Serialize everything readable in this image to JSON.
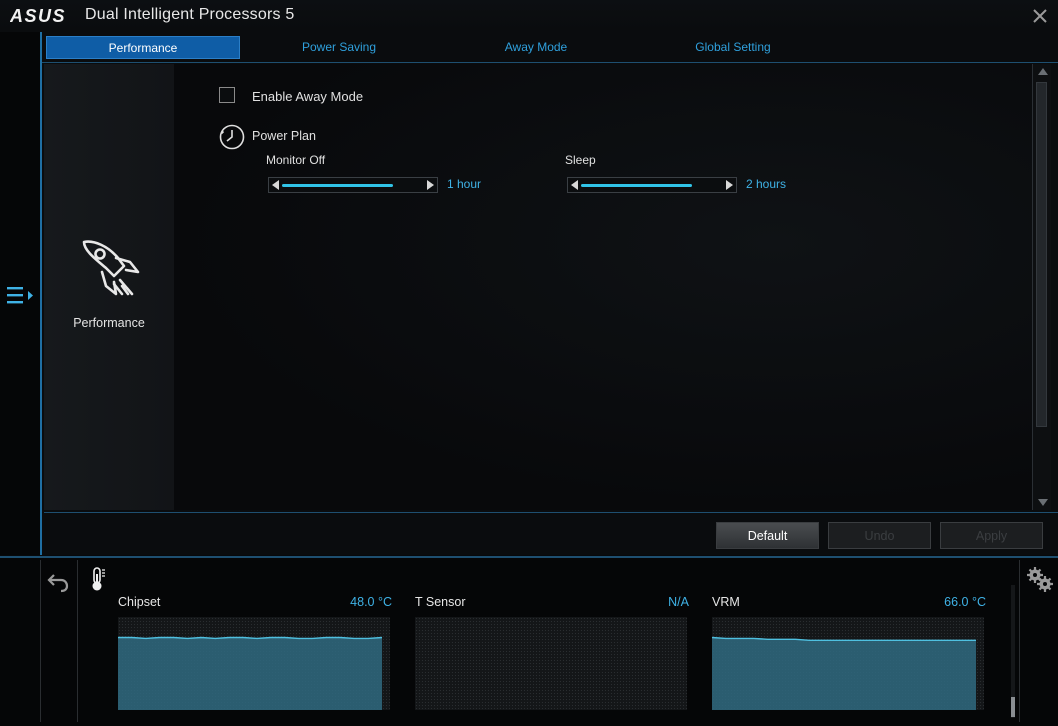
{
  "window": {
    "logo_text": "ASUS",
    "title": "Dual Intelligent Processors 5",
    "close_icon": "close-icon"
  },
  "tabs": [
    {
      "label": "Performance",
      "active": true
    },
    {
      "label": "Power Saving",
      "active": false
    },
    {
      "label": "Away Mode",
      "active": false
    },
    {
      "label": "Global Setting",
      "active": false
    }
  ],
  "sidebar": {
    "icon": "rocket-icon",
    "label": "Performance"
  },
  "away_mode": {
    "enable_label": "Enable Away Mode",
    "enabled": false,
    "power_plan_label": "Power Plan",
    "monitor_off": {
      "title": "Monitor Off",
      "value": "1 hour",
      "level": 0.78
    },
    "sleep": {
      "title": "Sleep",
      "value": "2 hours",
      "level": 0.78
    }
  },
  "buttons": {
    "default": "Default",
    "undo": "Undo",
    "apply": "Apply"
  },
  "monitor": {
    "sensors": [
      {
        "name": "Chipset",
        "value": "48.0 °C",
        "history": [
          0.78,
          0.78,
          0.77,
          0.78,
          0.78,
          0.77,
          0.78,
          0.77,
          0.78,
          0.78,
          0.77,
          0.78,
          0.78,
          0.77,
          0.77,
          0.78,
          0.78,
          0.77,
          0.77,
          0.78
        ]
      },
      {
        "name": "T Sensor",
        "value": "N/A",
        "history": []
      },
      {
        "name": "VRM",
        "value": "66.0 °C",
        "history": [
          0.78,
          0.77,
          0.77,
          0.77,
          0.76,
          0.76,
          0.76,
          0.75,
          0.75,
          0.75,
          0.75,
          0.75,
          0.75,
          0.75,
          0.75,
          0.75,
          0.75,
          0.75,
          0.75,
          0.75
        ]
      }
    ]
  },
  "colors": {
    "accent": "#31c4e8",
    "tab_active": "#0f5da6",
    "value_text": "#3fb2e6",
    "graph_fill": "#2f6a80"
  }
}
